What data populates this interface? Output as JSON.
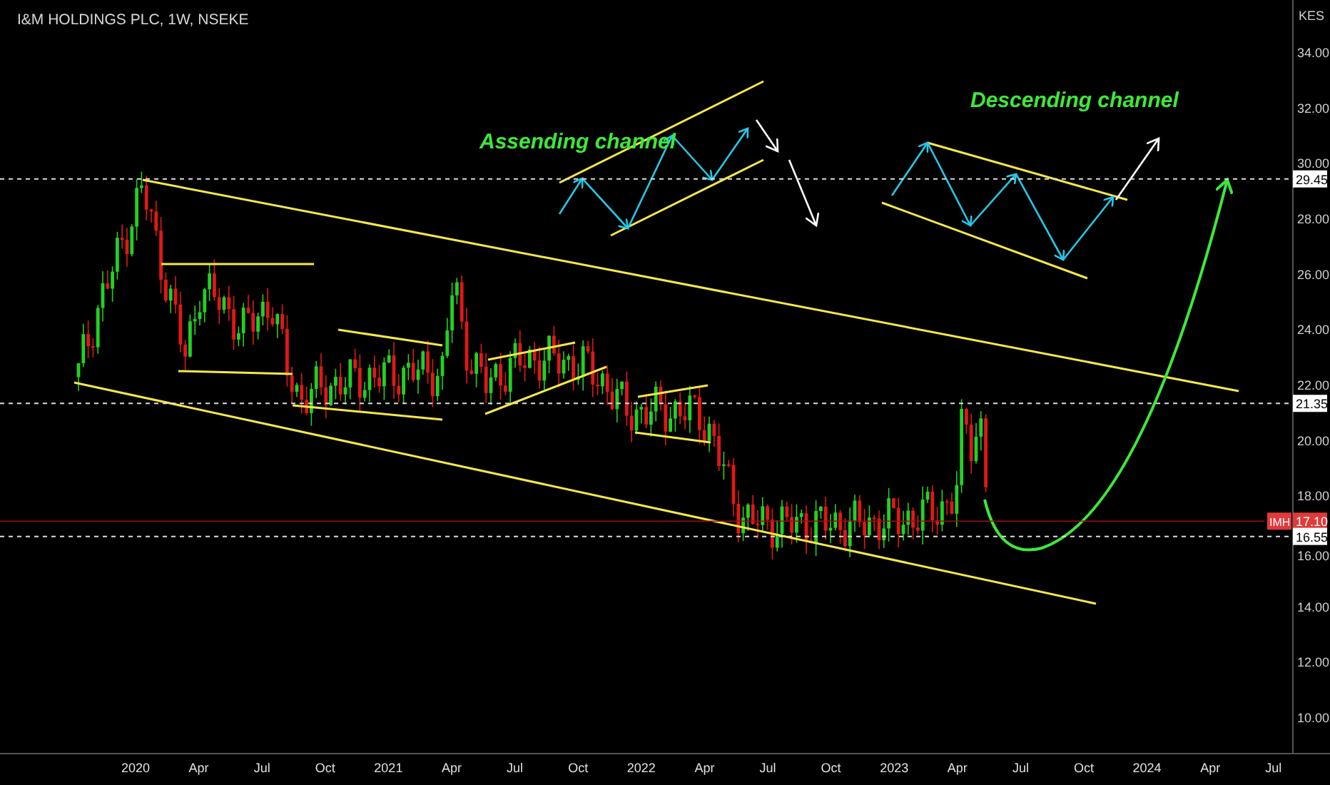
{
  "title": "I&M HOLDINGS PLC, 1W, NSEKE",
  "currency": "KES",
  "price_axis": [
    "34.00",
    "32.00",
    "30.00",
    "28.00",
    "26.00",
    "24.00",
    "22.00",
    "20.00",
    "18.00",
    "16.00",
    "14.00",
    "12.00",
    "10.00"
  ],
  "time_axis": [
    "2020",
    "Apr",
    "Jul",
    "Oct",
    "2021",
    "Apr",
    "Jul",
    "Oct",
    "2022",
    "Apr",
    "Jul",
    "Oct",
    "2023",
    "Apr",
    "Jul",
    "Oct",
    "2024",
    "Apr",
    "Jul"
  ],
  "price_tags": [
    {
      "kind": "level",
      "label": "29.45"
    },
    {
      "kind": "level",
      "label": "21.35"
    },
    {
      "kind": "last",
      "symbol": "IMH",
      "label": "17.10"
    },
    {
      "kind": "level",
      "label": "16.55"
    }
  ],
  "annotations": [
    {
      "text": "Assending channel"
    },
    {
      "text": "Descending channel"
    }
  ]
}
